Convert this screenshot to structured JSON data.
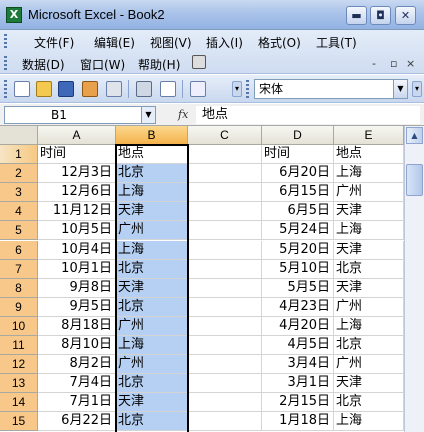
{
  "window": {
    "title": "Microsoft Excel - Book2",
    "app_icon_glyph": "X",
    "controls": {
      "minimize": "▬",
      "restore": "◘",
      "close": "✕"
    }
  },
  "menu": {
    "row1": [
      "文件(F)",
      "编辑(E)",
      "视图(V)",
      "插入(I)",
      "格式(O)",
      "工具(T)"
    ],
    "row2": [
      "数据(D)",
      "窗口(W)",
      "帮助(H)"
    ],
    "mdi_controls": {
      "minimize": "-",
      "restore": "▫",
      "close": "×"
    }
  },
  "toolbar": {
    "font_name": "宋体",
    "icons": [
      "new-icon",
      "open-icon",
      "save-icon",
      "permission-icon",
      "print-preview-icon",
      "print-icon",
      "search-icon",
      "spelling-icon"
    ]
  },
  "formula_bar": {
    "name_box": "B1",
    "fx": "fx",
    "content": "地点"
  },
  "sheet": {
    "columns": [
      "A",
      "B",
      "C",
      "D",
      "E"
    ],
    "rows": [
      {
        "n": "1",
        "a": "时间",
        "b": "地点",
        "d": "时间",
        "e": "地点"
      },
      {
        "n": "2",
        "a": "12月3日",
        "b": "北京",
        "d": "6月20日",
        "e": "上海"
      },
      {
        "n": "3",
        "a": "12月6日",
        "b": "上海",
        "d": "6月15日",
        "e": "广州"
      },
      {
        "n": "4",
        "a": "11月12日",
        "b": "天津",
        "d": "6月5日",
        "e": "天津"
      },
      {
        "n": "5",
        "a": "10月5日",
        "b": "广州",
        "d": "5月24日",
        "e": "上海"
      },
      {
        "n": "6",
        "a": "10月4日",
        "b": "上海",
        "d": "5月20日",
        "e": "天津"
      },
      {
        "n": "7",
        "a": "10月1日",
        "b": "北京",
        "d": "5月10日",
        "e": "北京"
      },
      {
        "n": "8",
        "a": "9月8日",
        "b": "天津",
        "d": "5月5日",
        "e": "天津"
      },
      {
        "n": "9",
        "a": "9月5日",
        "b": "北京",
        "d": "4月23日",
        "e": "广州"
      },
      {
        "n": "10",
        "a": "8月18日",
        "b": "广州",
        "d": "4月20日",
        "e": "上海"
      },
      {
        "n": "11",
        "a": "8月10日",
        "b": "上海",
        "d": "4月5日",
        "e": "北京"
      },
      {
        "n": "12",
        "a": "8月2日",
        "b": "广州",
        "d": "3月4日",
        "e": "广州"
      },
      {
        "n": "13",
        "a": "7月4日",
        "b": "北京",
        "d": "3月1日",
        "e": "天津"
      },
      {
        "n": "14",
        "a": "7月1日",
        "b": "天津",
        "d": "2月15日",
        "e": "北京"
      },
      {
        "n": "15",
        "a": "6月22日",
        "b": "北京",
        "d": "1月18日",
        "e": "上海"
      }
    ]
  },
  "colors": {
    "selection_fill": "#b5d0f2",
    "selected_header": "#f5b24c",
    "excel_green": "#1e7a3a"
  }
}
